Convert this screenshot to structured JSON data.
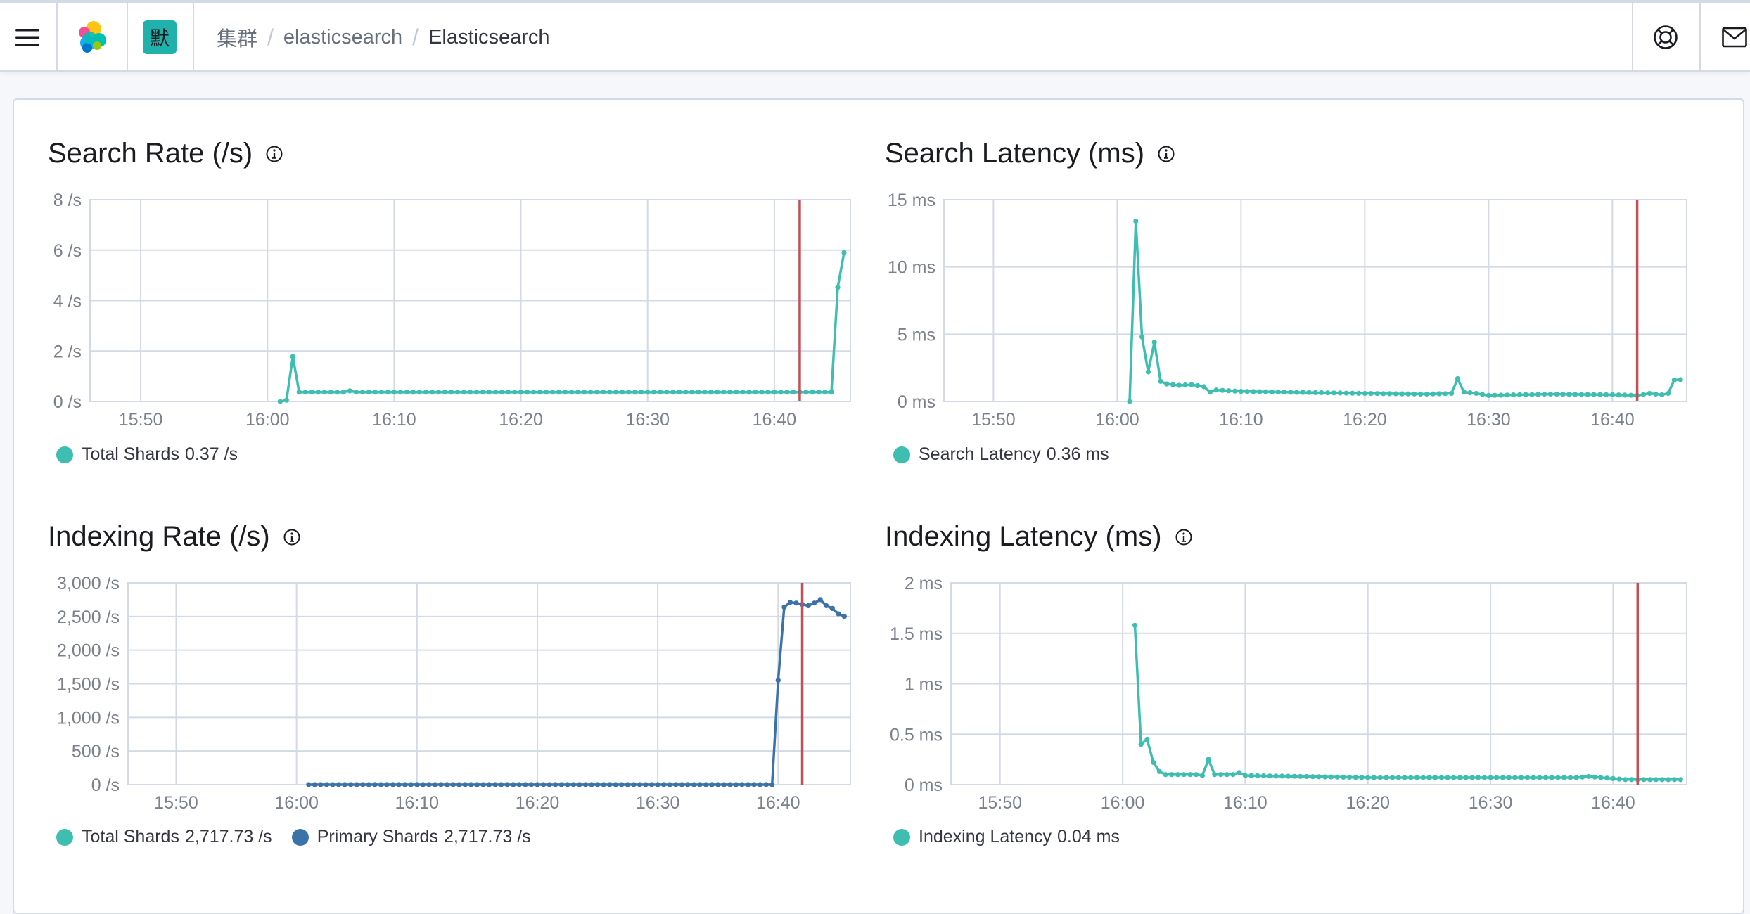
{
  "header": {
    "space_initial": "默",
    "breadcrumbs": [
      "集群",
      "elasticsearch",
      "Elasticsearch"
    ]
  },
  "icons": {
    "menu": "hamburger-icon",
    "logo": "elastic-logo-icon",
    "help": "help-lifebuoy-icon",
    "mail": "mail-icon",
    "info": "info-icon"
  },
  "colors": {
    "teal": "#3ebeb0",
    "blue": "#3b72a8",
    "marker": "#c44f56",
    "grid": "#d3dae6",
    "tick": "#7b818b"
  },
  "charts": {
    "search_rate": {
      "title": "Search Rate (/s)",
      "legend": [
        {
          "label": "Total Shards",
          "value": "0.37 /s",
          "color": "#3ebeb0"
        }
      ]
    },
    "search_latency": {
      "title": "Search Latency (ms)",
      "legend": [
        {
          "label": "Search Latency",
          "value": "0.36 ms",
          "color": "#3ebeb0"
        }
      ]
    },
    "indexing_rate": {
      "title": "Indexing Rate (/s)",
      "legend": [
        {
          "label": "Total Shards",
          "value": "2,717.73 /s",
          "color": "#3ebeb0"
        },
        {
          "label": "Primary Shards",
          "value": "2,717.73 /s",
          "color": "#3b72a8"
        }
      ]
    },
    "indexing_latency": {
      "title": "Indexing Latency (ms)",
      "legend": [
        {
          "label": "Indexing Latency",
          "value": "0.04 ms",
          "color": "#3ebeb0"
        }
      ]
    }
  },
  "chart_data": [
    {
      "id": "search_rate",
      "type": "line",
      "title": "Search Rate (/s)",
      "x_ticks": [
        "15:50",
        "16:00",
        "16:10",
        "16:20",
        "16:30",
        "16:40"
      ],
      "y_ticks": [
        "0 /s",
        "2 /s",
        "4 /s",
        "6 /s",
        "8 /s"
      ],
      "ylim": [
        0,
        8
      ],
      "xlim_minutes": [
        "15:46",
        "16:46"
      ],
      "marker_time": "16:42",
      "grid": true,
      "legend_position": "bottom-left",
      "series": [
        {
          "name": "Total Shards",
          "color": "#3ebeb0",
          "points": [
            [
              "16:01",
              0
            ],
            [
              "16:01:30",
              0.05
            ],
            [
              "16:02",
              1.78
            ],
            [
              "16:02:30",
              0.37
            ],
            [
              "16:06",
              0.37
            ],
            [
              "16:06:30",
              0.42
            ],
            [
              "16:07",
              0.37
            ],
            [
              "16:44:30",
              0.37
            ],
            [
              "16:45",
              4.52
            ],
            [
              "16:45:30",
              5.9
            ]
          ]
        }
      ]
    },
    {
      "id": "search_latency",
      "type": "line",
      "title": "Search Latency (ms)",
      "x_ticks": [
        "15:50",
        "16:00",
        "16:10",
        "16:20",
        "16:30",
        "16:40"
      ],
      "y_ticks": [
        "0 ms",
        "5 ms",
        "10 ms",
        "15 ms"
      ],
      "ylim": [
        0,
        15
      ],
      "marker_time": "16:42",
      "grid": true,
      "legend_position": "bottom-left",
      "series": [
        {
          "name": "Search Latency",
          "color": "#3ebeb0",
          "points": [
            [
              "16:01",
              0
            ],
            [
              "16:01:30",
              13.4
            ],
            [
              "16:02",
              4.8
            ],
            [
              "16:02:30",
              2.2
            ],
            [
              "16:03",
              4.4
            ],
            [
              "16:03:30",
              1.5
            ],
            [
              "16:04",
              1.3
            ],
            [
              "16:05",
              1.2
            ],
            [
              "16:06",
              1.25
            ],
            [
              "16:07",
              1.1
            ],
            [
              "16:07:30",
              0.7
            ],
            [
              "16:08",
              0.85
            ],
            [
              "16:10",
              0.75
            ],
            [
              "16:20",
              0.6
            ],
            [
              "16:25",
              0.55
            ],
            [
              "16:27",
              0.6
            ],
            [
              "16:27:30",
              1.7
            ],
            [
              "16:28",
              0.7
            ],
            [
              "16:29",
              0.6
            ],
            [
              "16:30",
              0.45
            ],
            [
              "16:35",
              0.55
            ],
            [
              "16:40",
              0.5
            ],
            [
              "16:42",
              0.45
            ],
            [
              "16:43",
              0.6
            ],
            [
              "16:44",
              0.5
            ],
            [
              "16:44:30",
              0.6
            ],
            [
              "16:45",
              1.6
            ],
            [
              "16:45:30",
              1.62
            ]
          ]
        }
      ]
    },
    {
      "id": "indexing_rate",
      "type": "line",
      "title": "Indexing Rate (/s)",
      "x_ticks": [
        "15:50",
        "16:00",
        "16:10",
        "16:20",
        "16:30",
        "16:40"
      ],
      "y_ticks": [
        "0 /s",
        "500 /s",
        "1,000 /s",
        "1,500 /s",
        "2,000 /s",
        "2,500 /s",
        "3,000 /s"
      ],
      "ylim": [
        0,
        3000
      ],
      "marker_time": "16:42",
      "grid": true,
      "legend_position": "bottom-left",
      "series": [
        {
          "name": "Total Shards",
          "color": "#3ebeb0",
          "points": []
        },
        {
          "name": "Primary Shards",
          "color": "#3b72a8",
          "points": [
            [
              "16:01",
              0
            ],
            [
              "16:39:30",
              0
            ],
            [
              "16:40",
              1550
            ],
            [
              "16:40:30",
              2640
            ],
            [
              "16:41",
              2710
            ],
            [
              "16:41:30",
              2700
            ],
            [
              "16:42",
              2680
            ],
            [
              "16:42:30",
              2660
            ],
            [
              "16:43",
              2700
            ],
            [
              "16:43:30",
              2750
            ],
            [
              "16:44",
              2660
            ],
            [
              "16:44:30",
              2620
            ],
            [
              "16:45",
              2540
            ],
            [
              "16:45:30",
              2500
            ]
          ]
        }
      ]
    },
    {
      "id": "indexing_latency",
      "type": "line",
      "title": "Indexing Latency (ms)",
      "x_ticks": [
        "15:50",
        "16:00",
        "16:10",
        "16:20",
        "16:30",
        "16:40"
      ],
      "y_ticks": [
        "0 ms",
        "0.5 ms",
        "1 ms",
        "1.5 ms",
        "2 ms"
      ],
      "ylim": [
        0,
        2
      ],
      "marker_time": "16:42",
      "grid": true,
      "legend_position": "bottom-left",
      "series": [
        {
          "name": "Indexing Latency",
          "color": "#3ebeb0",
          "points": [
            [
              "16:01",
              1.58
            ],
            [
              "16:01:30",
              0.4
            ],
            [
              "16:02",
              0.45
            ],
            [
              "16:02:30",
              0.22
            ],
            [
              "16:03",
              0.13
            ],
            [
              "16:03:30",
              0.1
            ],
            [
              "16:06",
              0.1
            ],
            [
              "16:06:30",
              0.09
            ],
            [
              "16:07",
              0.25
            ],
            [
              "16:07:30",
              0.1
            ],
            [
              "16:09",
              0.1
            ],
            [
              "16:09:30",
              0.12
            ],
            [
              "16:10",
              0.09
            ],
            [
              "16:20",
              0.07
            ],
            [
              "16:30",
              0.07
            ],
            [
              "16:37",
              0.07
            ],
            [
              "16:38",
              0.08
            ],
            [
              "16:40",
              0.06
            ],
            [
              "16:41",
              0.05
            ],
            [
              "16:45:30",
              0.05
            ]
          ]
        }
      ]
    }
  ]
}
